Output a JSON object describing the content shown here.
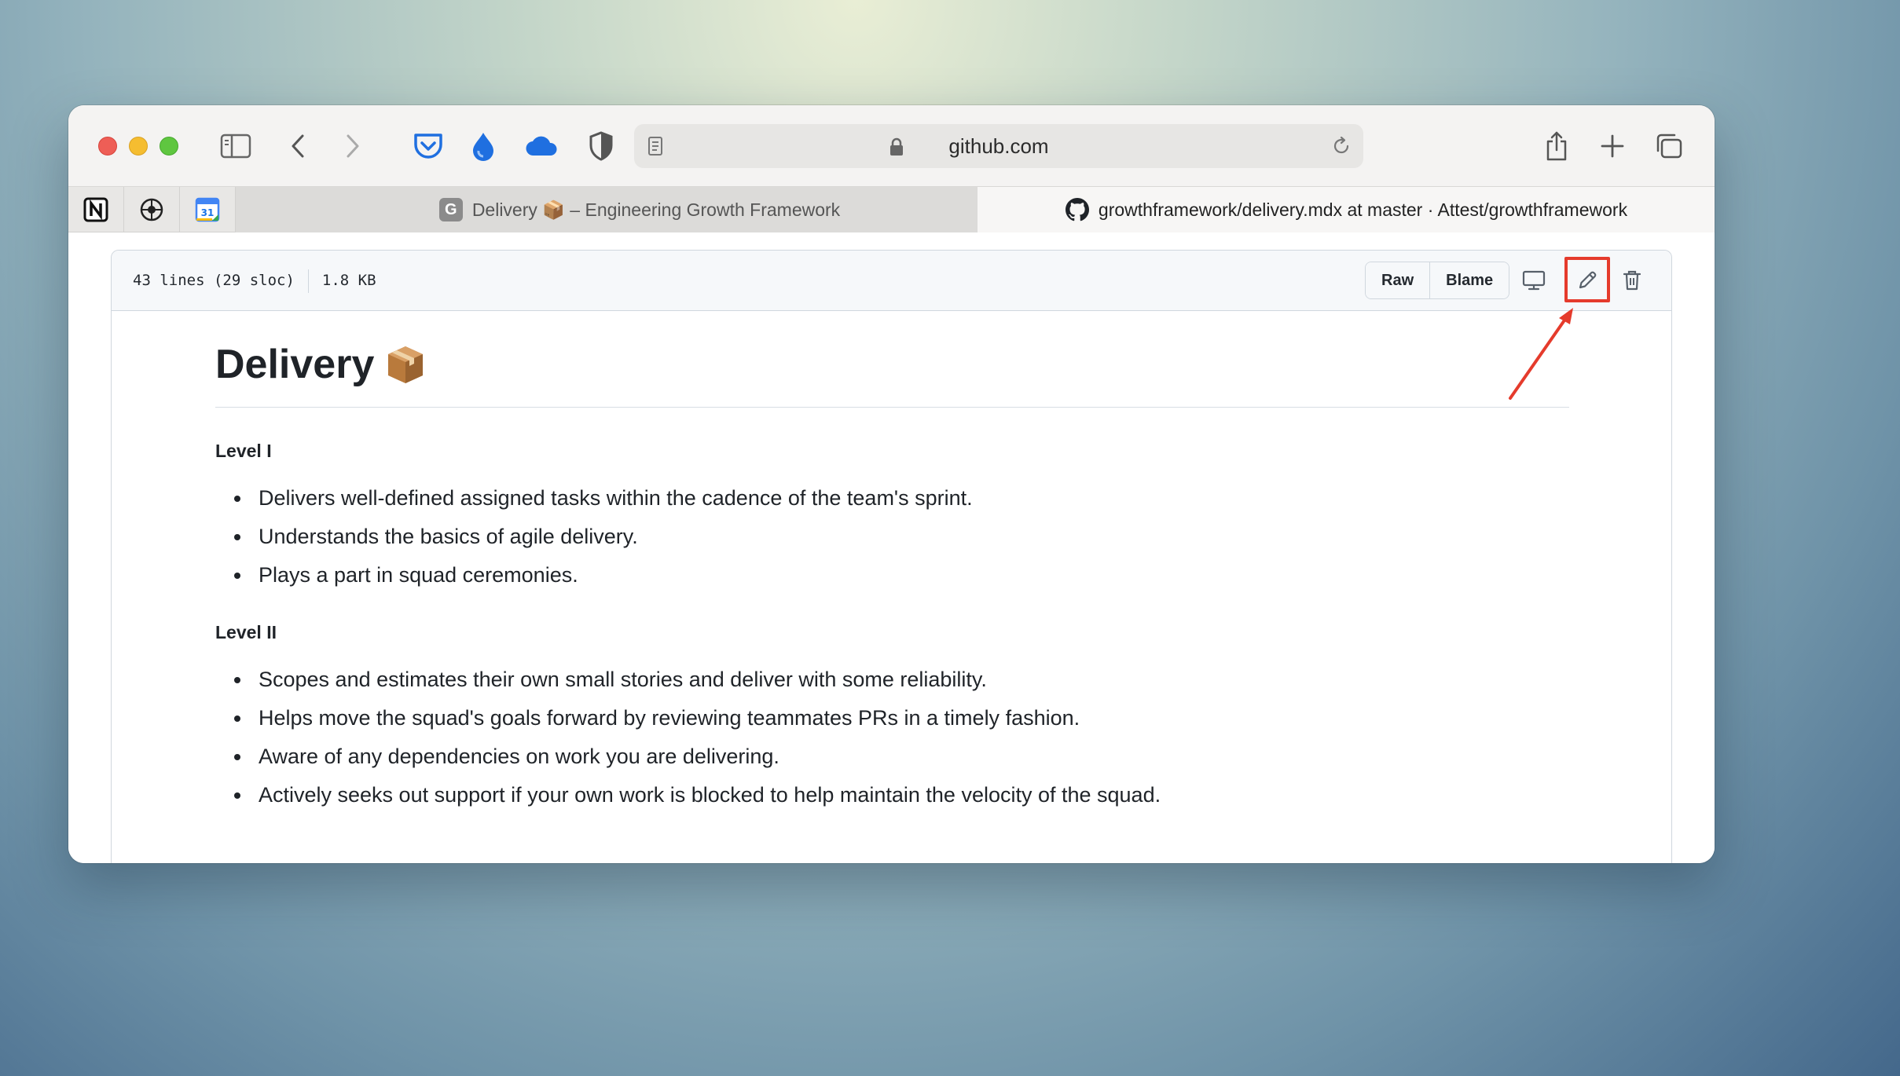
{
  "browser": {
    "address": "github.com",
    "tabs": [
      {
        "label": "Delivery 📦 – Engineering Growth Framework",
        "favicon": "G",
        "active": false
      },
      {
        "label": "growthframework/delivery.mdx at master · Attest/growthframework",
        "favicon": "github-icon",
        "active": true
      }
    ],
    "pinned_tabs": [
      "notion-icon",
      "compass-icon",
      "calendar-icon"
    ],
    "calendar_day": "31",
    "extensions": [
      "pocket-icon",
      "drop-icon",
      "cloud-icon",
      "shield-icon"
    ]
  },
  "file": {
    "lines": "43 lines (29 sloc)",
    "size": "1.8 KB",
    "raw_label": "Raw",
    "blame_label": "Blame"
  },
  "doc": {
    "title": "Delivery",
    "title_emoji": "package",
    "sections": [
      {
        "heading": "Level I",
        "items": [
          "Delivers well-defined assigned tasks within the cadence of the team's sprint.",
          "Understands the basics of agile delivery.",
          "Plays a part in squad ceremonies."
        ]
      },
      {
        "heading": "Level II",
        "items": [
          "Scopes and estimates their own small stories and deliver with some reliability.",
          "Helps move the squad's goals forward by reviewing teammates PRs in a timely fashion.",
          "Aware of any dependencies on work you are delivering.",
          "Actively seeks out support if your own work is blocked to help maintain the velocity of the squad."
        ]
      }
    ]
  },
  "annotation": {
    "color": "#e53b2c",
    "target": "edit-file-icon"
  }
}
